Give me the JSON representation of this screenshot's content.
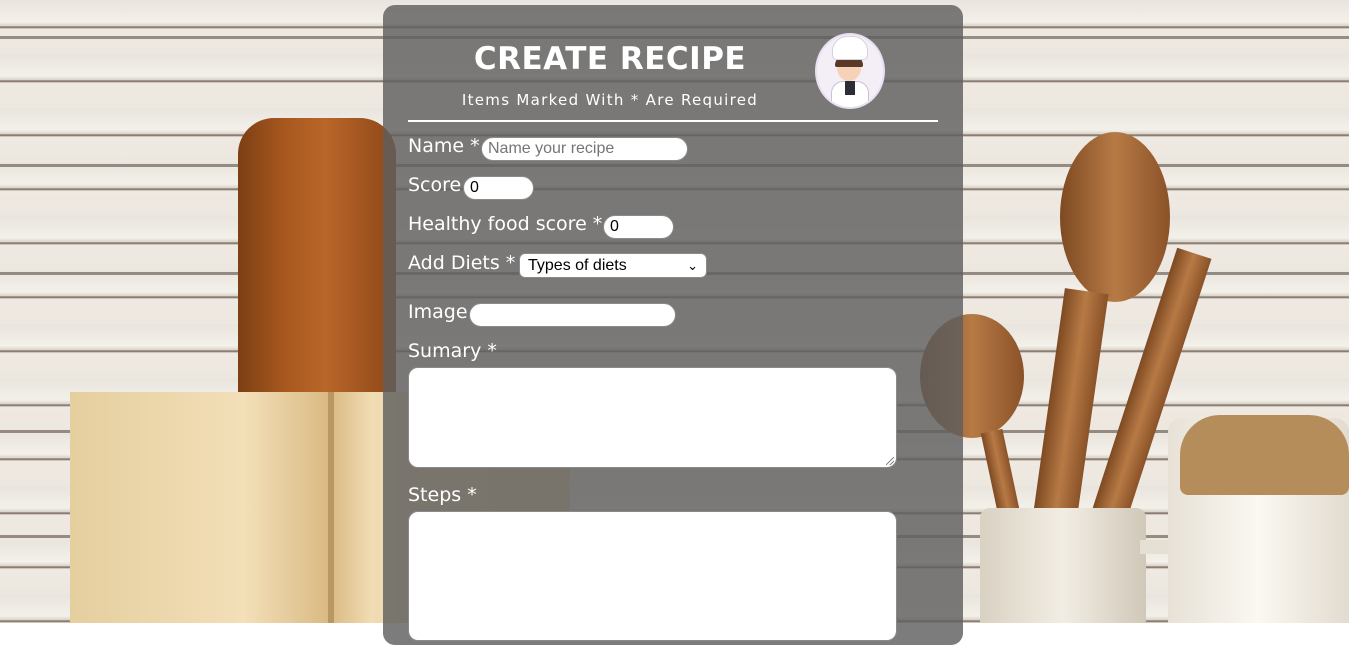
{
  "form": {
    "title": "CREATE RECIPE",
    "subtitle": "Items Marked With * Are Required",
    "name_label": "Name *",
    "name_placeholder": "Name your recipe",
    "score_label": "Score",
    "score_value": "0",
    "healthy_label": "Healthy food score *",
    "healthy_value": "0",
    "diets_label": "Add Diets *",
    "diets_selected": "Types of diets",
    "image_label": "Image",
    "image_value": "",
    "summary_label": "Sumary *",
    "steps_label": "Steps *"
  },
  "icons": {
    "chef_avatar": "chef-avatar-icon",
    "select_arrow": "chevron-down-icon"
  },
  "colors": {
    "panel_bg": "#5f5f5f",
    "text": "#ffffff"
  }
}
